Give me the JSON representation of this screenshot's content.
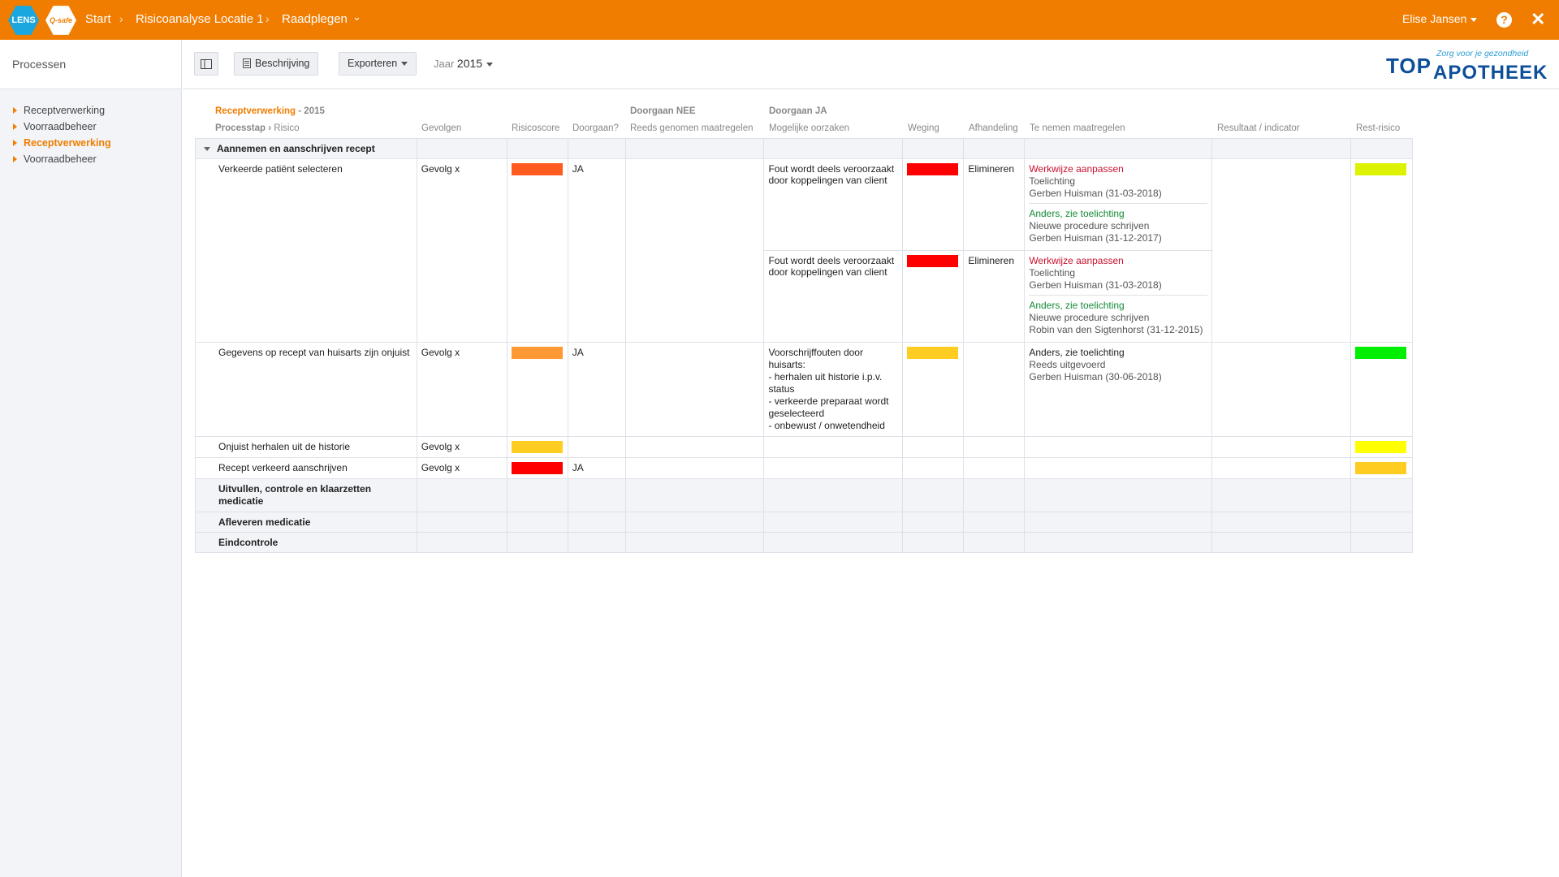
{
  "topbar": {
    "lens_label": "LENS",
    "qsafe_label": "Q-safe",
    "breadcrumb": [
      "Start",
      "Risicoanalyse Locatie 1",
      "Raadplegen"
    ],
    "user": "Elise Jansen",
    "help": "?",
    "close": "✕"
  },
  "sidebar": {
    "title": "Processen",
    "items": [
      {
        "label": "Receptverwerking"
      },
      {
        "label": "Voorraadbeheer"
      },
      {
        "label": "Receptverwerking"
      },
      {
        "label": "Voorraadbeheer"
      }
    ]
  },
  "toolbar": {
    "beschrijving": "Beschrijving",
    "exporteren": "Exporteren",
    "jaar_label": "Jaar",
    "jaar_value": "2015"
  },
  "logo": {
    "top": "TOP",
    "apotheek": "APOTHEEK",
    "slogan": "Zorg voor je gezondheid"
  },
  "headers": {
    "section_name": "Receptverwerking",
    "section_year": "- 2015",
    "doorgaan_nee": "Doorgaan NEE",
    "doorgaan_ja": "Doorgaan JA",
    "processtap": "Processtap",
    "risico": "Risico",
    "gevolgen": "Gevolgen",
    "risicoscore": "Risicoscore",
    "doorgaan": "Doorgaan?",
    "reeds": "Reeds genomen maatregelen",
    "oorzaken": "Mogelijke oorzaken",
    "weging": "Weging",
    "afhandeling": "Afhandeling",
    "maatregelen": "Te nemen maatregelen",
    "resultaat": "Resultaat / indicator",
    "restrisico": "Rest-risico"
  },
  "colors": {
    "orange_red": "#ff5a1f",
    "red": "#ff0000",
    "orange": "#ff9933",
    "amber": "#ffcc22",
    "yellow": "#ffff00",
    "yellow_green": "#ddf200",
    "green": "#00ee00"
  },
  "table": {
    "group1": "Aannemen en aanschrijven recept",
    "rows": [
      {
        "risico": "Verkeerde patiënt selecteren",
        "gevolg": "Gevolg x",
        "doorgaan": "JA",
        "cause1": "Fout wordt deels veroorzaakt door koppelingen van client",
        "afh1": "Elimineren",
        "cause2": "Fout wordt deels veroorzaakt door koppelingen van client",
        "afh2": "Elimineren",
        "act1_title": "Werkwijze aanpassen",
        "act1_note": "Toelichting",
        "act1_person": "Gerben Huisman (31-03-2018)",
        "act2_title": "Anders, zie toelichting",
        "act2_note": "Nieuwe procedure schrijven",
        "act2_person": "Gerben Huisman (31-12-2017)",
        "act3_title": "Werkwijze aanpassen",
        "act3_note": "Toelichting",
        "act3_person": "Gerben Huisman (31-03-2018)",
        "act4_title": "Anders, zie toelichting",
        "act4_note": "Nieuwe procedure schrijven",
        "act4_person": "Robin van den Sigtenhorst (31-12-2015)"
      },
      {
        "risico": "Gegevens op recept van huisarts zijn onjuist",
        "gevolg": "Gevolg x",
        "doorgaan": "JA",
        "cause_l1": "Voorschrijffouten door huisarts:",
        "cause_l2": "- herhalen uit historie i.p.v. status",
        "cause_l3": "- verkeerde preparaat wordt geselecteerd",
        "cause_l4": "- onbewust / onwetendheid",
        "act_title": "Anders, zie toelichting",
        "act_note": "Reeds uitgevoerd",
        "act_person": "Gerben Huisman (30-06-2018)"
      },
      {
        "risico": "Onjuist herhalen uit de historie",
        "gevolg": "Gevolg x"
      },
      {
        "risico": "Recept verkeerd aanschrijven",
        "gevolg": "Gevolg x",
        "doorgaan": "JA"
      }
    ],
    "group2": "Uitvullen, controle en klaarzetten medicatie",
    "group3": "Afleveren medicatie",
    "group4": "Eindcontrole"
  }
}
